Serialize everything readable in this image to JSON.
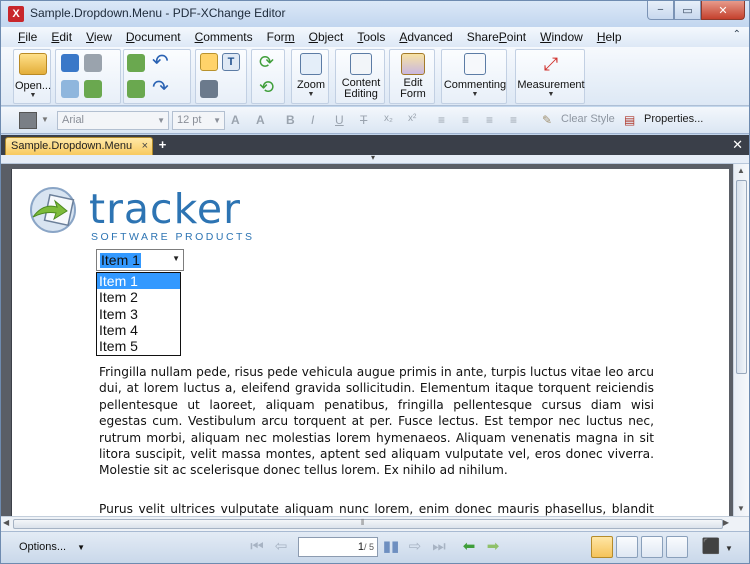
{
  "window": {
    "title": "Sample.Dropdown.Menu - PDF-XChange Editor",
    "app_icon_glyph": "X",
    "controls": [
      "−",
      "▭",
      "✕"
    ]
  },
  "menu": [
    "File",
    "Edit",
    "View",
    "Document",
    "Comments",
    "Form",
    "Object",
    "Tools",
    "Advanced",
    "SharePoint",
    "Window",
    "Help"
  ],
  "menu_underline": [
    "F",
    "E",
    "V",
    "D",
    "C",
    "m",
    "O",
    "T",
    "A",
    "P",
    "W",
    "H"
  ],
  "toolbar1": {
    "open_label": "Open...",
    "zoom_label": "Zoom",
    "content_editing_label_1": "Content",
    "content_editing_label_2": "Editing",
    "edit_form_label_1": "Edit",
    "edit_form_label_2": "Form",
    "commenting_label": "Commenting",
    "measurement_label": "Measurement"
  },
  "toolbar2": {
    "font_name": "Arial",
    "font_size": "12 pt",
    "clear_style_label": "Clear Style",
    "properties_label": "Properties..."
  },
  "tabs": {
    "active_tab": "Sample.Dropdown.Menu",
    "close_glyph": "×",
    "new_tab_glyph": "+"
  },
  "document": {
    "logo_word": "tracker",
    "logo_sub": "SOFTWARE PRODUCTS",
    "dropdown_value": "Item 1",
    "dropdown_options": [
      "Item 1",
      "Item 2",
      "Item 3",
      "Item 4",
      "Item 5"
    ],
    "paragraph1": "Fringilla nullam pede, risus pede vehicula augue primis in ante, turpis luctus vitae leo arcu dui, at lorem luctus a, eleifend gravida sollicitudin. Elementum itaque torquent reiciendis pellentesque ut laoreet, aliquam penatibus, fringilla pellentesque cursus diam wisi egestas cum. Vestibulum arcu torquent at per. Fusce lectus. Est tempor nec luctus nec, rutrum morbi, aliquam nec molestias lorem hymenaeos. Aliquam venenatis magna in sit litora suscipit, velit massa montes, aptent sed aliquam vulputate vel, eros donec viverra. Molestie sit ac scelerisque donec tellus lorem. Ex nihilo ad nihilum.",
    "paragraph2": "Purus velit ultrices vulputate aliquam nunc lorem, enim donec mauris phasellus, blandit lorem"
  },
  "statusbar": {
    "options_label": "Options...",
    "current_page": "1",
    "total_pages": "/ 5"
  },
  "colors": {
    "accent_tab": "#f8c960",
    "logo_blue": "#2d74b3",
    "selection_blue": "#3399ff"
  }
}
